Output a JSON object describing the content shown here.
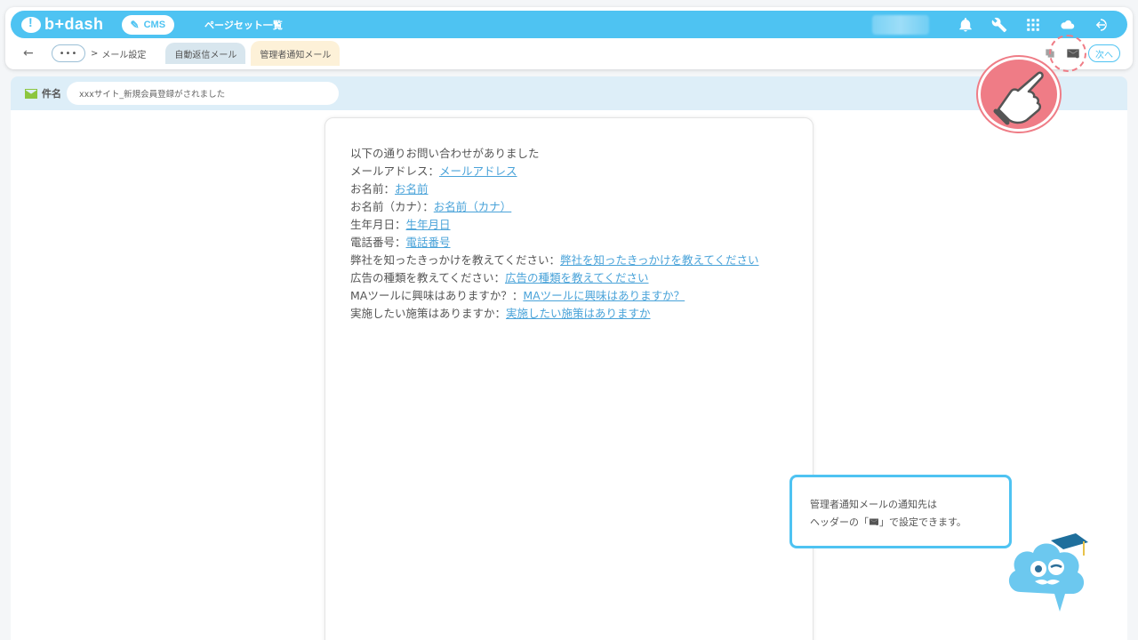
{
  "header": {
    "logo_text": "b+dash",
    "cms_label": "CMS",
    "nav_link": "ページセット一覧",
    "icons": [
      "bell-icon",
      "wrench-icon",
      "grid-icon",
      "ai-cloud-icon",
      "logout-icon"
    ]
  },
  "breadcrumb": {
    "back_symbol": "←",
    "more_symbol": "•••",
    "separator": ">",
    "current": "メール設定",
    "tabs": [
      {
        "label": "自動返信メール",
        "active": false
      },
      {
        "label": "管理者通知メール",
        "active": true
      }
    ],
    "next_label": "次へ"
  },
  "subject": {
    "label": "件名",
    "value": "xxxサイト_新規会員登録がされました"
  },
  "mail_body": {
    "intro": "以下の通りお問い合わせがありました",
    "fields": [
      {
        "label": "メールアドレス：",
        "tag": "メールアドレス"
      },
      {
        "label": "お名前：",
        "tag": "お名前"
      },
      {
        "label": "お名前（カナ）：",
        "tag": "お名前（カナ）"
      },
      {
        "label": "生年月日：",
        "tag": "生年月日"
      },
      {
        "label": "電話番号：",
        "tag": "電話番号"
      },
      {
        "label": "弊社を知ったきっかけを教えてください：",
        "tag": "弊社を知ったきっかけを教えてください"
      },
      {
        "label": "広告の種類を教えてください：",
        "tag": "広告の種類を教えてください"
      },
      {
        "label": "MAツールに興味はありますか？：",
        "tag": "MAツールに興味はありますか？"
      },
      {
        "label": "実施したい施策はありますか：",
        "tag": "実施したい施策はありますか"
      }
    ]
  },
  "tooltip": {
    "line1": "管理者通知メールの通知先は",
    "line2_prefix": "ヘッダーの「",
    "line2_suffix": "」で設定できます。"
  },
  "colors": {
    "accent": "#4ec3f2",
    "link": "#4aa3d9",
    "pointer": "#ef7c86",
    "subject_bg": "#ddeef8"
  }
}
